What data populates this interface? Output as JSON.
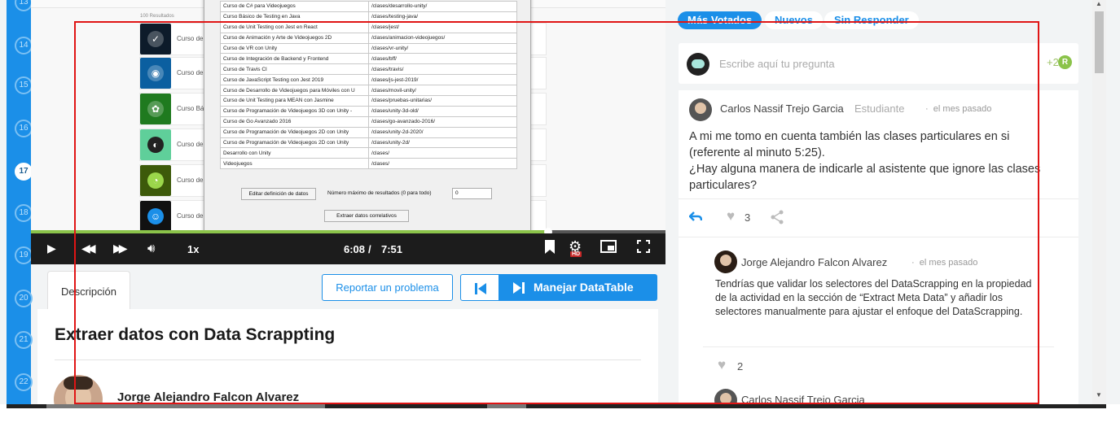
{
  "timeline": {
    "numbers": [
      "13",
      "14",
      "15",
      "16",
      "17",
      "18",
      "19",
      "20",
      "21",
      "22"
    ],
    "active": "17"
  },
  "video": {
    "results_label": "100 Resultados",
    "courses": [
      {
        "label": "Curso de F",
        "color": "#0d1b2a"
      },
      {
        "label": "Curso de C",
        "color": "#0b5fa0"
      },
      {
        "label": "Curso Bás",
        "color": "#1f7a1f"
      },
      {
        "label": "Curso de F",
        "color": "#5fcf9a"
      },
      {
        "label": "Curso de A",
        "color": "#3d5a0a"
      },
      {
        "label": "Curso de V",
        "color": "#111111"
      }
    ],
    "table_rows": [
      [
        "Curso de C# para Videojuegos",
        "/clases/desarrollo-unity/"
      ],
      [
        "Curso Básico de Testing en Java",
        "/clases/testing-java/"
      ],
      [
        "Curso de Unit Testing con Jest en React",
        "/clases/jest/"
      ],
      [
        "Curso de Animación y Arte de Videojuegos 2D",
        "/clases/animacion-videojuegos/"
      ],
      [
        "Curso de VR con Unity",
        "/clases/vr-unity/"
      ],
      [
        "Curso de Integración de Backend y Frontend",
        "/clases/bff/"
      ],
      [
        "Curso de Travis CI",
        "/clases/travis/"
      ],
      [
        "Curso de JavaScript Testing con Jest 2019",
        "/clases/js-jest-2019/"
      ],
      [
        "Curso de Desarrollo de Videojuegos para Móviles con U",
        "/clases/movil-unity/"
      ],
      [
        "Curso de Unit Testing para MEAN con Jasmine",
        "/clases/pruebas-unitarias/"
      ],
      [
        "Curso de Programación de Videojuegos 3D con Unity -",
        "/clases/unity-3d-old/"
      ],
      [
        "Curso de Go Avanzado 2016",
        "/clases/go-avanzado-2016/"
      ],
      [
        "Curso de Programación de Videojuegos 2D con Unity",
        "/clases/unity-2d-2020/"
      ],
      [
        "Curso de Programación de Videojuegos 2D con Unity",
        "/clases/unity-2d/"
      ],
      [
        "Desarrollo con Unity",
        "/clases/"
      ],
      [
        "Videojuegos",
        "/clases/"
      ]
    ],
    "edit_button": "Editar definición de datos",
    "max_results_label": "Número máximo de resultados (0 para todo)",
    "max_results_value": "0",
    "extract_button": "Extraer datos correlativos",
    "progress": 0.815,
    "speed": "1x",
    "time_current": "6:08",
    "time_separator": "/",
    "time_total": "7:51",
    "hd_badge": "HD"
  },
  "lesson": {
    "tab_description": "Descripción",
    "report_button": "Reportar un problema",
    "next_button": "Manejar DataTable",
    "title": "Extraer datos con Data Scrappting",
    "author": "Jorge Alejandro Falcon Alvarez"
  },
  "discussion": {
    "filters": [
      "Más Votados",
      "Nuevos",
      "Sin Responder"
    ],
    "ask_placeholder": "Escribe aquí tu pregunta",
    "ask_points": "+2",
    "ask_badge": "R",
    "question": {
      "author": "Carlos Nassif Trejo Garcia",
      "role": "Estudiante",
      "separator": "·",
      "time": "el mes pasado",
      "body_lines": [
        "A mi me tomo en cuenta también las clases particulares en si",
        "(referente al minuto 5:25).",
        "¿Hay alguna manera de indicarle al asistente que ignore las clases",
        "particulares?"
      ],
      "likes": "3"
    },
    "answer": {
      "author": "Jorge Alejandro Falcon Alvarez",
      "separator": "·",
      "time": "el mes pasado",
      "body": "Tendrías que validar los selectores del DataScrapping en la propiedad de la actividad en la sección de “Extract Meta Data” y añadir los selectores manualmente para ajustar el enfoque del DataScrapping.",
      "likes": "2"
    },
    "next_author": "Carlos Nassif Trejo Garcia"
  },
  "colors": {
    "accent": "#1b8fe8",
    "progress": "#8bc34a",
    "annotation": "#e01515"
  }
}
